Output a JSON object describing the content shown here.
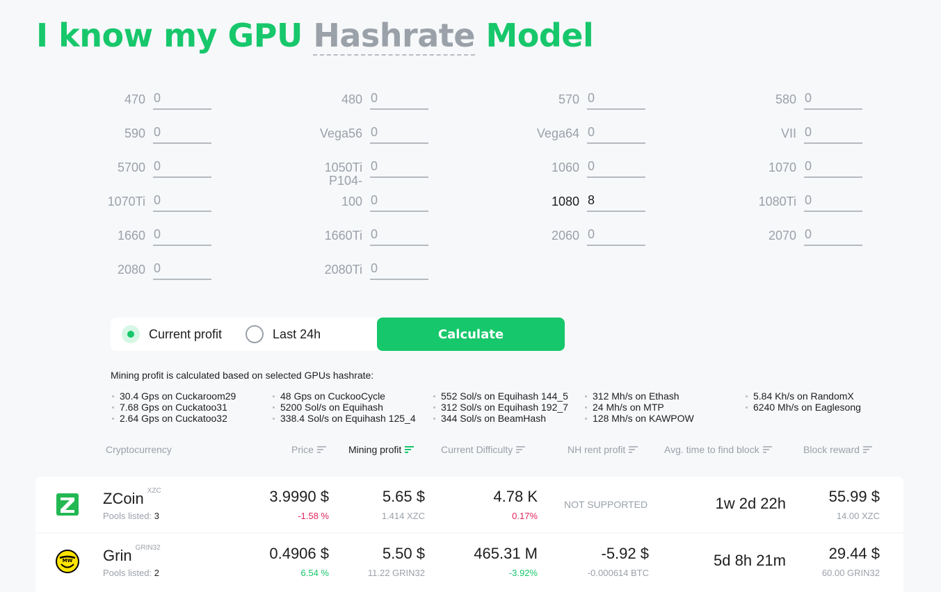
{
  "title": {
    "prefix": "I know my GPU",
    "mode": "Hashrate",
    "suffix": "Model"
  },
  "colors": {
    "accent": "#17c76b",
    "negative": "#e0245e",
    "muted": "#9aa1a9"
  },
  "gpus": [
    {
      "label": "470",
      "value": "0"
    },
    {
      "label": "480",
      "value": "0"
    },
    {
      "label": "570",
      "value": "0"
    },
    {
      "label": "580",
      "value": "0"
    },
    {
      "label": "590",
      "value": "0"
    },
    {
      "label": "Vega56",
      "value": "0"
    },
    {
      "label": "Vega64",
      "value": "0"
    },
    {
      "label": "VII",
      "value": "0"
    },
    {
      "label": "5700",
      "value": "0"
    },
    {
      "label": "1050Ti",
      "value": "0"
    },
    {
      "label": "1060",
      "value": "0"
    },
    {
      "label": "1070",
      "value": "0"
    },
    {
      "label": "1070Ti",
      "value": "0"
    },
    {
      "label": "P104-100",
      "value": "0"
    },
    {
      "label": "1080",
      "value": "8"
    },
    {
      "label": "1080Ti",
      "value": "0"
    },
    {
      "label": "1660",
      "value": "0"
    },
    {
      "label": "1660Ti",
      "value": "0"
    },
    {
      "label": "2060",
      "value": "0"
    },
    {
      "label": "2070",
      "value": "0"
    },
    {
      "label": "2080",
      "value": "0"
    },
    {
      "label": "2080Ti",
      "value": "0"
    }
  ],
  "controls": {
    "current_profit": "Current profit",
    "last_24h": "Last 24h",
    "calculate": "Calculate"
  },
  "info": {
    "title": "Mining profit is calculated based on selected GPUs hashrate:",
    "columns": [
      [
        "30.4 Gps on Cuckaroom29",
        "7.68 Gps on Cuckatoo31",
        "2.64 Gps on Cuckatoo32"
      ],
      [
        "48 Gps on CuckooCycle",
        "5200 Sol/s on Equihash",
        "338.4 Sol/s on Equihash 125_4"
      ],
      [
        "552 Sol/s on Equihash 144_5",
        "312 Sol/s on Equihash 192_7",
        "344 Sol/s on BeamHash"
      ],
      [
        "312 Mh/s on Ethash",
        "24 Mh/s on MTP",
        "128 Mh/s on KAWPOW"
      ],
      [
        "5.84 Kh/s on RandomX",
        "6240 Mh/s on Eaglesong"
      ]
    ]
  },
  "table": {
    "headers": {
      "crypto": "Cryptocurrency",
      "price": "Price",
      "profit": "Mining profit",
      "difficulty": "Current Difficulty",
      "nh": "NH rent profit",
      "time": "Avg. time to find block",
      "reward": "Block reward"
    },
    "rows": [
      {
        "name": "ZCoin",
        "ticker": "XZC",
        "pools_label": "Pools listed:",
        "pools": "3",
        "price": "3.9990 $",
        "price_change": "-1.58 %",
        "profit": "5.65 $",
        "profit_coin": "1.414 XZC",
        "difficulty": "4.78 K",
        "difficulty_change": "0.17%",
        "nh": "NOT SUPPORTED",
        "time": "1w 2d 22h",
        "reward": "55.99 $",
        "reward_coin": "14.00 XZC"
      },
      {
        "name": "Grin",
        "ticker": "GRIN32",
        "pools_label": "Pools listed:",
        "pools": "2",
        "price": "0.4906 $",
        "price_change": "6.54 %",
        "profit": "5.50 $",
        "profit_coin": "11.22 GRIN32",
        "difficulty": "465.31 M",
        "difficulty_change": "-3.92%",
        "nh": "-5.92 $",
        "nh_btc": "-0.000614 BTC",
        "time": "5d 8h 21m",
        "reward": "29.44 $",
        "reward_coin": "60.00 GRIN32"
      }
    ]
  }
}
